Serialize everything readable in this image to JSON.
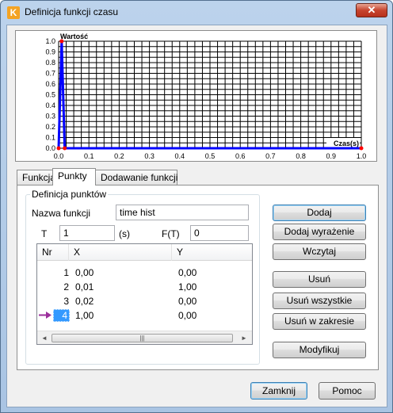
{
  "window": {
    "title": "Definicja funkcji czasu",
    "close_label": "✕",
    "app_icon_letter": "K"
  },
  "chart_data": {
    "type": "line",
    "ylabel": "Wartość",
    "xlabel": "Czas(s)",
    "x_ticks": [
      "0.0",
      "0.1",
      "0.2",
      "0.3",
      "0.4",
      "0.5",
      "0.6",
      "0.7",
      "0.8",
      "0.9",
      "1.0"
    ],
    "y_ticks": [
      "0.0",
      "0.1",
      "0.2",
      "0.3",
      "0.4",
      "0.5",
      "0.6",
      "0.7",
      "0.8",
      "0.9",
      "1.0"
    ],
    "xlim": [
      0,
      1.0
    ],
    "ylim": [
      0,
      1.0
    ],
    "grid": true,
    "series": [
      {
        "x": [
          0.0,
          0.01,
          0.02,
          1.0
        ],
        "y": [
          0.0,
          1.0,
          0.0,
          0.0
        ]
      }
    ],
    "line_color": "#0000ff",
    "point_color": "#ff0000"
  },
  "tabs": [
    {
      "label": "Funkcja",
      "active": false
    },
    {
      "label": "Punkty",
      "active": true
    },
    {
      "label": "Dodawanie funkcji",
      "active": false
    }
  ],
  "form": {
    "group_label": "Definicja punktów",
    "name_label": "Nazwa funkcji",
    "name_value": "time hist",
    "t_label": "T",
    "t_value": "1",
    "t_unit": "(s)",
    "ft_label": "F(T)",
    "ft_value": "0"
  },
  "table": {
    "columns": [
      "Nr",
      "X",
      "Y"
    ],
    "rows": [
      {
        "nr": "1",
        "x": "0,00",
        "y": "0,00"
      },
      {
        "nr": "2",
        "x": "0,01",
        "y": "1,00"
      },
      {
        "nr": "3",
        "x": "0,02",
        "y": "0,00"
      },
      {
        "nr": "4",
        "x": "1,00",
        "y": "0,00"
      }
    ],
    "selected_row": 3,
    "scroll_left": "◄",
    "scroll_right": "►",
    "thumb_grip": "|||"
  },
  "buttons": {
    "dodaj": "Dodaj",
    "dodaj_wyrazenie": "Dodaj wyrażenie",
    "wczytaj": "Wczytaj",
    "usun": "Usuń",
    "usun_wszystkie": "Usuń wszystkie",
    "usun_w_zakresie": "Usuń w zakresie",
    "modyfikuj": "Modyfikuj",
    "zamknij": "Zamknij",
    "pomoc": "Pomoc"
  }
}
